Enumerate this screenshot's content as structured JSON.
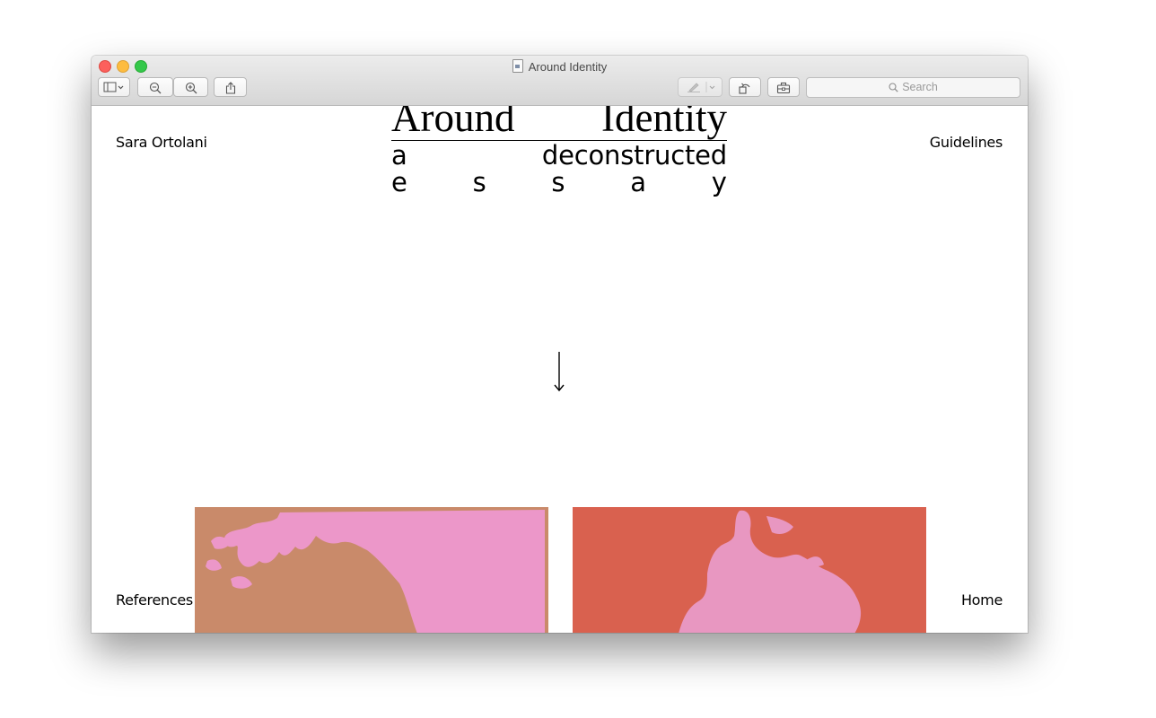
{
  "window": {
    "title": "Around Identity"
  },
  "toolbar": {
    "search_placeholder": "Search"
  },
  "page": {
    "author": "Sara Ortolani",
    "title_word1": "Around",
    "title_word2": "Identity",
    "subtitle_a": "a",
    "subtitle_b": "deconstructed",
    "essay_letters": [
      "e",
      "s",
      "s",
      "a",
      "y"
    ],
    "nav": {
      "top_right": "Guidelines",
      "bottom_left": "References",
      "bottom_right": "Home"
    }
  },
  "colors": {
    "image1_bg": "#c98a6a",
    "image1_shape": "#ec97c9",
    "image2_bg": "#d9614f",
    "image2_shape": "#e897c1"
  }
}
